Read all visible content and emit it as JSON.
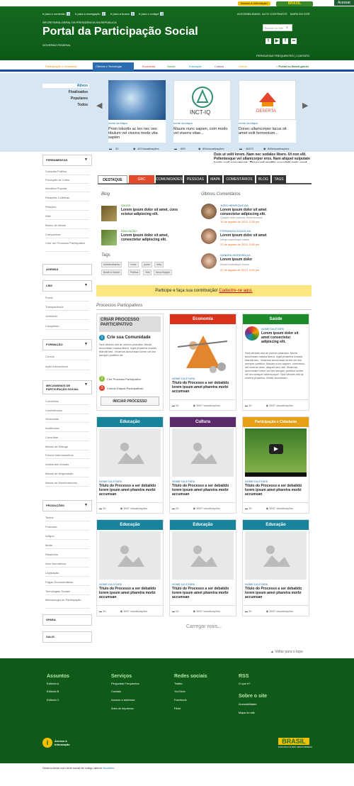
{
  "topbar": {
    "acesso_info": "Acesso à Informação",
    "brasil": "BRASIL",
    "acessar": "Acessar"
  },
  "header": {
    "access_links": [
      {
        "label": "Ir para o conteúdo",
        "num": "1"
      },
      {
        "label": "Ir para a navegação",
        "num": "2"
      },
      {
        "label": "Ir para a busca",
        "num": "3"
      },
      {
        "label": "Ir para o rodapé",
        "num": "4"
      }
    ],
    "top_links": [
      "ACESSIBILIDADE",
      "ALTO CONTRASTE",
      "MAPA DO SITE"
    ],
    "secretaria": "SECRETARIA-GERAL DA PRESIDÊNCIA DA REPÚBLICA",
    "title": "Portal da Participação Social",
    "gov": "GOVERNO FEDERAL",
    "search_placeholder": "Buscar no Site",
    "bottom_links": "PERGUNTAS FREQUENTES | CONTATO"
  },
  "nav": {
    "items": [
      "Participação e Cidadania",
      "Ciência e Tecnologia",
      "Economia",
      "Saúde",
      "Educação",
      "Cultura",
      "Outros"
    ],
    "right": "Portal no Brasil.gov.br",
    "colors": [
      "#f28c00",
      "#2b6cb0",
      "#d9281c",
      "#2f8e2f",
      "#1a8fb3",
      "#7b2b86",
      "#f2a100"
    ]
  },
  "dropdown": {
    "items": [
      "Ativos",
      "Finalizados",
      "Populares",
      "Todos"
    ],
    "cards": [
      {
        "meta": "nome da etapa",
        "text": "Proin lobortis ac leo nec ves tibulum vel viverra modo vita sapien"
      },
      {
        "meta": "nome da etapa",
        "text": "Mauris nunc sapien, com modo vel viverra vitae..."
      },
      {
        "meta": "nome da etapa",
        "text": "Donec ullamcorper lacus sit amet velit fermentum..."
      }
    ],
    "logo2": "INCT-IQ",
    "logo3": "DESERTA",
    "stats": [
      "30",
      "437visualizações",
      "659",
      "654visualizações",
      "46572",
      "645visualizações"
    ]
  },
  "snippet": "Duis ut velit lorem. Nam nec sodales libero. Ut non elit. Pellentesque vel ullamcorper eros. Nam aliquet vulputate justo sed accumsan. Praesent mattis suscipit ante eget gravida. Maecenas lorem fringilla vitae pellentesque rot.",
  "sidebar": {
    "sections": [
      {
        "title": "FERRAMENTAS",
        "items": [
          "Consulta Pública",
          "Produção de Vídeo",
          "Iniciativa Popular",
          "Relações Coletivas",
          "Petições",
          "Wiki",
          "Banco de Ideias",
          "Campanhas",
          "Criar um Processo Participativo"
        ]
      },
      {
        "title": "AGENDA",
        "items": []
      },
      {
        "title": "LEIS",
        "items": [
          "Portal",
          "Transparência",
          "Judiciário",
          "Congresso"
        ]
      },
      {
        "title": "FORMAÇÃO",
        "items": [
          "Cursos",
          "Ação educacional"
        ]
      },
      {
        "title": "MECANISMOS DE PARTICIPAÇÃO SOCIAL",
        "items": [
          "Conselhos",
          "Conferências",
          "Ouvidorias",
          "Audiências",
          "Consultas",
          "Mesas de Diálogo",
          "Fóruns Interconselhos",
          "Ambientes Virtuais",
          "Mesas de Negociação",
          "Mesas de Monitoramento"
        ]
      },
      {
        "title": "PRODUÇÕES",
        "items": [
          "Textos",
          "Podcasts",
          "Artigos",
          "Mídia",
          "Relatórios",
          "Atos Normativos",
          "Legislação",
          "Pagas Documentárias",
          "Tecnologias Sociais",
          "Metodologia de Participação"
        ]
      },
      {
        "title": "SPARA",
        "items": []
      },
      {
        "title": "SALIS",
        "items": []
      }
    ]
  },
  "tabs": [
    "DESTAQUE",
    "GRC",
    "COMUNIDADES",
    "PESSOAS",
    "MAPA",
    "COMENTÁRIOS",
    "BLOG",
    "TAGS"
  ],
  "blog": {
    "heading": "Blog",
    "posts": [
      {
        "cat": "SAÚDE",
        "title": "Lorem ipsum dolor sit amet, cons ectetur adipiscing elit."
      },
      {
        "cat": "EDUCAÇÃO",
        "title": "Lorem ipsum dolor sit amet, consectetur adipiscing elit."
      }
    ],
    "tags_heading": "Tags",
    "tags": [
      "entretenimento",
      "crime",
      "jovem",
      "infra",
      "Brasil & Saúde",
      "Pública",
      "Test",
      "Nova Equipe"
    ]
  },
  "comments": {
    "heading": "Últimos Comentários",
    "items": [
      {
        "author": "JOÃO HENRIQUE DA",
        "text": "Lorem ipsum dolor sit amet consectetur adipiscing elit.",
        "sub": "Quisque dolor pulvinar, Morbi tincidunt",
        "date": "15 de agosto de 2013, 2:35 pm"
      },
      {
        "author": "FERNANDA SOUZA DA",
        "text": "Lorem ipsum dolor sit amet",
        "sub": "Integer scelerisque massa",
        "date": "22 de agosto de 2013, 2:45 pm"
      },
      {
        "author": "SANDRA MOREIRA DA",
        "text": "Lorem ipsum dolor",
        "sub": "Aliquet scelerisque massa",
        "date": "22 de agosto de 2013, 2:45 pm"
      }
    ]
  },
  "banner": {
    "text": "Participe e faça sua contribuição!",
    "link": "Cadastre-se aqui."
  },
  "processos_heading": "Processos Participativos",
  "criar": {
    "title": "CRIAR PROCESSO PARTICIPATIVO",
    "step1": "Crie sua Comunidade",
    "desc": "Sed ultrices nisl at viverra pharetra. Morbi accumsan massa libero, eget pharetra mauris blandit nec. Vivamus accumsan lorem vel leo semper porttitor sit.",
    "step2": "Crie Processo Participativo",
    "step3": "Cria/do Etapas Participativas",
    "button": "INICIAR PROCESSO"
  },
  "cards": [
    {
      "head": "Economia",
      "color": "#d9331c",
      "cat": "NOME DA ETAPA",
      "title": "Título do Processo a ser debatido lorem ipsum amet pharetra morbi accumsan",
      "likes": "30",
      "views": "3597 visualizações"
    },
    {
      "head": "Saúde",
      "color": "#1f8a2c",
      "cat": "NOME DA ETAPA",
      "title": "Lorem ipsum dolor sit amet consectetur adipiscing elit.",
      "likes": "30",
      "views": "3597 visualizações"
    },
    {
      "head": "Educação",
      "color": "#17849c",
      "cat": "NOME DA ETAPA",
      "title": "Título do Processo a ser debatido lorem ipsum amet pharetra morbi accumsan",
      "likes": "30",
      "views": "3597 visualizações"
    },
    {
      "head": "Cultura",
      "color": "#5a2a6b",
      "cat": "NOME DA ETAPA",
      "title": "Título do Processo a ser debatido lorem ipsum amet pharetra morbi accumsan",
      "likes": "30",
      "views": "3597 visualizações"
    },
    {
      "head": "Participação e Cidadania",
      "color": "#e6a017",
      "cat": "NOME DA ETAPA",
      "title": "Título do Processo a ser debatido lorem ipsum amet pharetra morbi accumsan",
      "likes": "30",
      "views": "3597 visualizações"
    },
    {
      "head": "Educação",
      "color": "#17849c",
      "cat": "NOME DA ETAPA",
      "title": "Título do Processo a ser debatido lorem ipsum amet pharetra morbi accumsan",
      "likes": "30",
      "views": "3597 visualizações"
    },
    {
      "head": "Educação",
      "color": "#17849c",
      "cat": "NOME DA ETAPA",
      "title": "Título do Processo a ser debatido lorem ipsum amet pharetra morbi accumsan",
      "likes": "30",
      "views": "3597 visualizações"
    },
    {
      "head": "Educação",
      "color": "#17849c",
      "cat": "NOME DA ETAPA",
      "title": "Título do Processo a ser debatido lorem ipsum amet pharetra morbi accumsan",
      "likes": "30",
      "views": "3597 visualizações"
    }
  ],
  "saude_desc": "Sed ultrices nisl at viverra pharetra. Morbi accumsan massa libero, eget pharetra mauris blandit nec. Vivamus accumsan lorem vel leo semper porttitor. Mauris nunc sapien, commodo vel viverra vitae, aliquet sed nisl. Vivamus accumsan lorem vel leo semper porttitor lorem vel leo semper ullamcorper. Sed ultrices nisl at viverra pharetra. Morbi accumsan.",
  "carregar": "Carregar mais...",
  "voltar": "Voltar para o topo",
  "footer": {
    "assuntos": {
      "head": "Assuntos",
      "items": [
        "Editoria A",
        "Editoria B",
        "Editoria C"
      ]
    },
    "servicos": {
      "head": "Serviços",
      "items": [
        "Perguntas Frequentes",
        "Contato",
        "Acesso a sistemas",
        "Área de imprensa"
      ]
    },
    "redes": {
      "head": "Redes sociais",
      "items": [
        "Twitter",
        "YouTube",
        "Facebook",
        "Flickr"
      ]
    },
    "rss": {
      "head": "RSS",
      "items": [
        "O que é?"
      ]
    },
    "sobre": {
      "head": "Sobre o site",
      "items": [
        "Acessibilidade",
        "Mapa do site"
      ]
    },
    "acesso_logo": "Acesso à Informação",
    "brasil_logo": "BRASIL",
    "brasil_sub": "PAÍS RICO É PAÍS SEM POBREZA"
  },
  "dev": {
    "text": "Desenvolvido com rede social de código aberto",
    "link": "Noosfero"
  }
}
